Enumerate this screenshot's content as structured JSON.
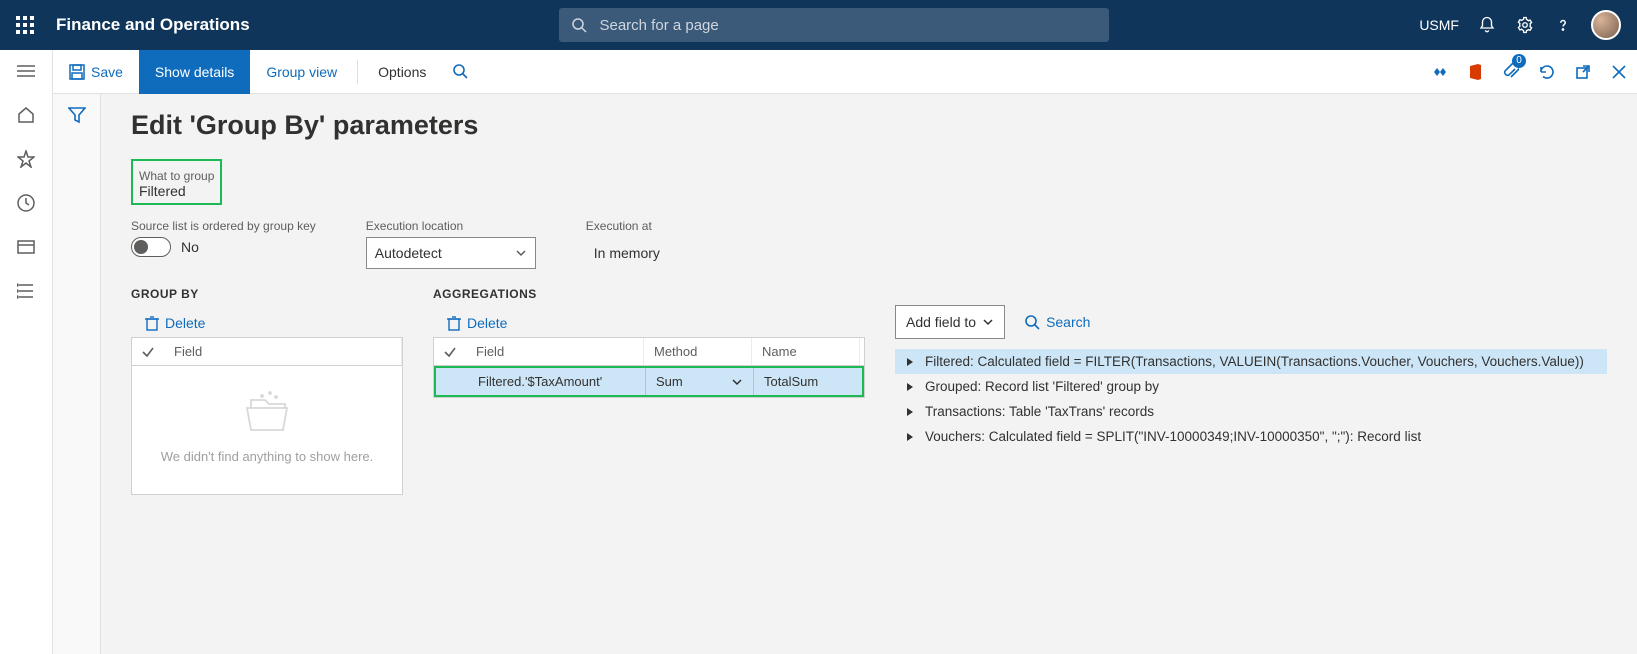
{
  "topbar": {
    "brand": "Finance and Operations",
    "search_placeholder": "Search for a page",
    "entity": "USMF"
  },
  "actionbar": {
    "save": "Save",
    "show_details": "Show details",
    "group_view": "Group view",
    "options": "Options",
    "badge": "0"
  },
  "page": {
    "title": "Edit 'Group By' parameters",
    "what_to_group_label": "What to group",
    "what_to_group_value": "Filtered",
    "ordered_label": "Source list is ordered by group key",
    "ordered_value": "No",
    "exec_loc_label": "Execution location",
    "exec_loc_value": "Autodetect",
    "exec_at_label": "Execution at",
    "exec_at_value": "In memory"
  },
  "groupby": {
    "heading": "GROUP BY",
    "delete": "Delete",
    "col_field": "Field",
    "empty": "We didn't find anything to show here."
  },
  "agg": {
    "heading": "AGGREGATIONS",
    "delete": "Delete",
    "col_field": "Field",
    "col_method": "Method",
    "col_name": "Name",
    "rows": [
      {
        "field": "Filtered.'$TaxAmount'",
        "method": "Sum",
        "name": "TotalSum"
      }
    ]
  },
  "tree": {
    "add_btn": "Add field to",
    "search": "Search",
    "items": [
      "Filtered: Calculated field = FILTER(Transactions, VALUEIN(Transactions.Voucher, Vouchers, Vouchers.Value))",
      "Grouped: Record list 'Filtered' group by",
      "Transactions: Table 'TaxTrans' records",
      "Vouchers: Calculated field = SPLIT(\"INV-10000349;INV-10000350\", \";\"): Record list"
    ]
  }
}
